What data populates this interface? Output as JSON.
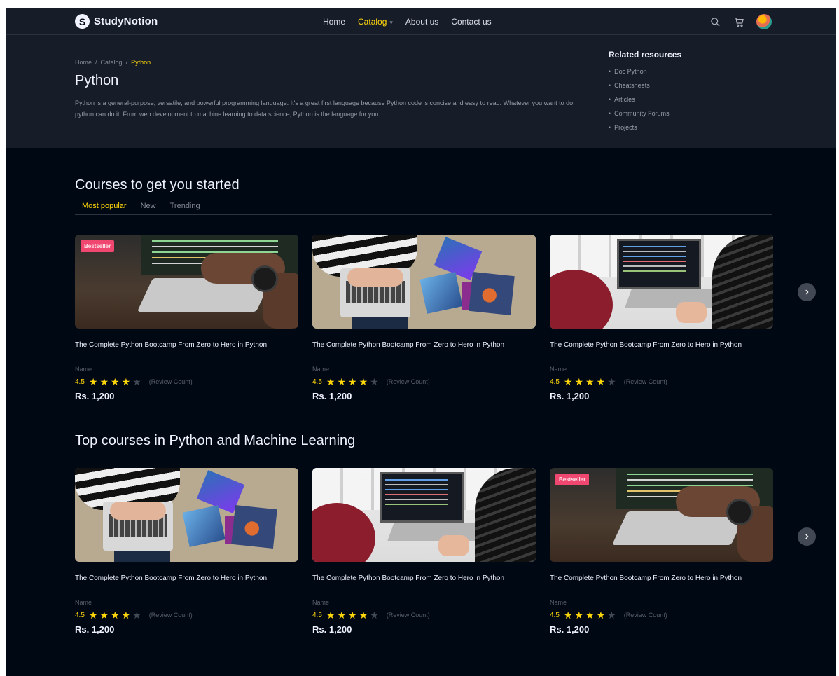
{
  "brand": {
    "logo_letter": "S",
    "name": "StudyNotion"
  },
  "nav": {
    "links": [
      "Home",
      "Catalog",
      "About us",
      "Contact us"
    ],
    "active": "Catalog",
    "icons": [
      "search-icon",
      "cart-icon",
      "avatar"
    ]
  },
  "hero": {
    "breadcrumb": [
      "Home",
      "Catalog",
      "Python"
    ],
    "title": "Python",
    "description": "Python is a general-purpose, versatile, and powerful programming language. It's a great first language because Python code is concise and easy to read. Whatever you want to do, python can do it. From web development to machine learning to data science, Python is the language for you.",
    "related": {
      "title": "Related resources",
      "items": [
        "Doc Python",
        "Cheatsheets",
        "Articles",
        "Community Forums",
        "Projects"
      ]
    }
  },
  "section1": {
    "title": "Courses to get you started",
    "tabs": [
      "Most popular",
      "New",
      "Trending"
    ],
    "active_tab": "Most popular",
    "cards": [
      {
        "badge": "Bestseller",
        "title": "The Complete Python Bootcamp From Zero to Hero in Python",
        "author": "Name",
        "rating": "4.5",
        "stars": 4,
        "reviews": "(Review Count)",
        "price": "Rs. 1,200",
        "image": "laptop-hands"
      },
      {
        "badge": "",
        "title": "The Complete Python Bootcamp From Zero to Hero in Python",
        "author": "Name",
        "rating": "4.5",
        "stars": 4,
        "reviews": "(Review Count)",
        "price": "Rs. 1,200",
        "image": "laptop-books"
      },
      {
        "badge": "",
        "title": "The Complete Python Bootcamp From Zero to Hero in Python",
        "author": "Name",
        "rating": "4.5",
        "stars": 4,
        "reviews": "(Review Count)",
        "price": "Rs. 1,200",
        "image": "office-laptop"
      }
    ]
  },
  "section2": {
    "title": "Top courses in Python and Machine Learning",
    "cards": [
      {
        "badge": "",
        "title": "The Complete Python Bootcamp From Zero to Hero in Python",
        "author": "Name",
        "rating": "4.5",
        "stars": 4,
        "reviews": "(Review Count)",
        "price": "Rs. 1,200",
        "image": "laptop-books"
      },
      {
        "badge": "",
        "title": "The Complete Python Bootcamp From Zero to Hero in Python",
        "author": "Name",
        "rating": "4.5",
        "stars": 4,
        "reviews": "(Review Count)",
        "price": "Rs. 1,200",
        "image": "office-laptop"
      },
      {
        "badge": "Bestseller",
        "title": "The Complete Python Bootcamp From Zero to Hero in Python",
        "author": "Name",
        "rating": "4.5",
        "stars": 4,
        "reviews": "(Review Count)",
        "price": "Rs. 1,200",
        "image": "laptop-hands"
      }
    ]
  },
  "colors": {
    "bg": "#000814",
    "panel": "#161d29",
    "accent": "#ffd60a",
    "badge": "#ef476f"
  }
}
